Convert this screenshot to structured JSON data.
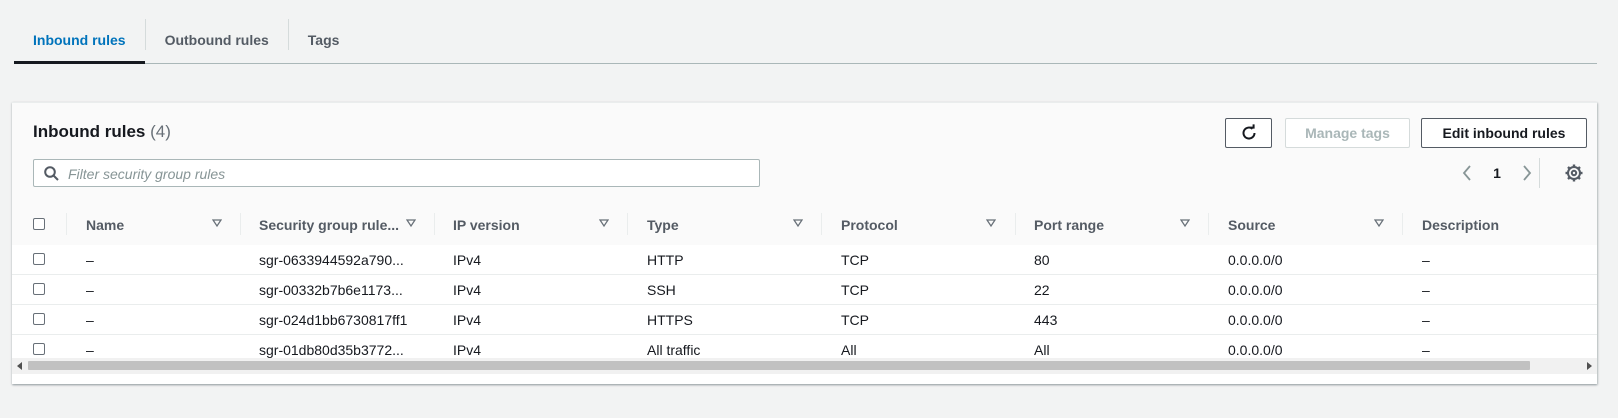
{
  "tabs": [
    {
      "label": "Inbound rules",
      "active": true
    },
    {
      "label": "Outbound rules",
      "active": false
    },
    {
      "label": "Tags",
      "active": false
    }
  ],
  "panel": {
    "title": "Inbound rules",
    "count": "(4)",
    "buttons": {
      "refresh_icon": "refresh-icon",
      "manage_tags": "Manage tags",
      "edit_inbound": "Edit inbound rules"
    },
    "search": {
      "placeholder": "Filter security group rules",
      "value": ""
    },
    "pagination": {
      "current_page": "1"
    }
  },
  "table": {
    "columns": [
      "Name",
      "Security group rule...",
      "IP version",
      "Type",
      "Protocol",
      "Port range",
      "Source",
      "Description"
    ],
    "rows": [
      {
        "name": "–",
        "rule_id": "sgr-0633944592a790...",
        "ip_version": "IPv4",
        "type": "HTTP",
        "protocol": "TCP",
        "port_range": "80",
        "source": "0.0.0.0/0",
        "description": "–"
      },
      {
        "name": "–",
        "rule_id": "sgr-00332b7b6e1173...",
        "ip_version": "IPv4",
        "type": "SSH",
        "protocol": "TCP",
        "port_range": "22",
        "source": "0.0.0.0/0",
        "description": "–"
      },
      {
        "name": "–",
        "rule_id": "sgr-024d1bb6730817ff1",
        "ip_version": "IPv4",
        "type": "HTTPS",
        "protocol": "TCP",
        "port_range": "443",
        "source": "0.0.0.0/0",
        "description": "–"
      },
      {
        "name": "–",
        "rule_id": "sgr-01db80d35b3772...",
        "ip_version": "IPv4",
        "type": "All traffic",
        "protocol": "All",
        "port_range": "All",
        "source": "0.0.0.0/0",
        "description": "–"
      }
    ]
  },
  "colors": {
    "accent": "#0073bb",
    "text": "#16191f",
    "muted": "#545b64",
    "disabled": "#aab7b8"
  }
}
